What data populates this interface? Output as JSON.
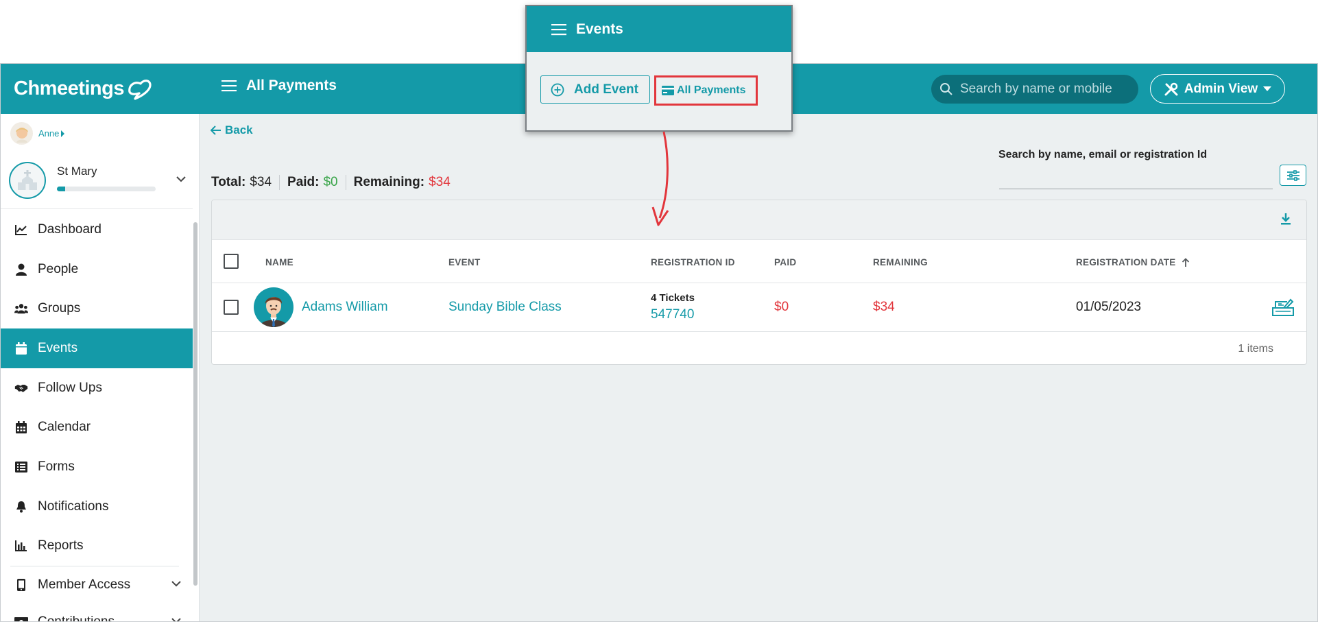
{
  "app": {
    "logo_text": "Chmeetings",
    "page_title": "All Payments",
    "search_placeholder": "Search by name or mobile",
    "admin_view_label": "Admin View"
  },
  "sidebar": {
    "user_name": "Anne",
    "church_name": "St Mary",
    "church_progress": 0.08,
    "items": [
      {
        "label": "Dashboard",
        "icon": "chart-line-icon"
      },
      {
        "label": "People",
        "icon": "user-icon"
      },
      {
        "label": "Groups",
        "icon": "users-icon"
      },
      {
        "label": "Events",
        "icon": "calendar-icon",
        "active": true
      },
      {
        "label": "Follow Ups",
        "icon": "handshake-icon"
      },
      {
        "label": "Calendar",
        "icon": "calendar-grid-icon"
      },
      {
        "label": "Forms",
        "icon": "list-icon"
      },
      {
        "label": "Notifications",
        "icon": "bell-icon"
      },
      {
        "label": "Reports",
        "icon": "bar-chart-icon"
      },
      {
        "label": "Member Access",
        "icon": "mobile-icon"
      },
      {
        "label": "Contributions",
        "icon": "money-icon"
      }
    ]
  },
  "main": {
    "back_label": "Back",
    "totals": {
      "total_label": "Total:",
      "total_value": "$34",
      "paid_label": "Paid:",
      "paid_value": "$0",
      "remaining_label": "Remaining:",
      "remaining_value": "$34"
    },
    "search_label": "Search by name, email or registration Id",
    "table": {
      "headers": [
        "NAME",
        "EVENT",
        "REGISTRATION ID",
        "PAID",
        "REMAINING",
        "REGISTRATION DATE"
      ],
      "rows": [
        {
          "name": "Adams William",
          "event": "Sunday Bible Class",
          "tickets": "4 Tickets",
          "registration_id": "547740",
          "paid": "$0",
          "remaining": "$34",
          "registration_date": "01/05/2023"
        }
      ],
      "footer": "1 items"
    }
  },
  "popup": {
    "title": "Events",
    "add_event_label": "Add Event",
    "all_payments_label": "All Payments"
  },
  "colors": {
    "brand": "#149aa8",
    "highlight": "#e2363c",
    "paid_green": "#3aa54a"
  }
}
